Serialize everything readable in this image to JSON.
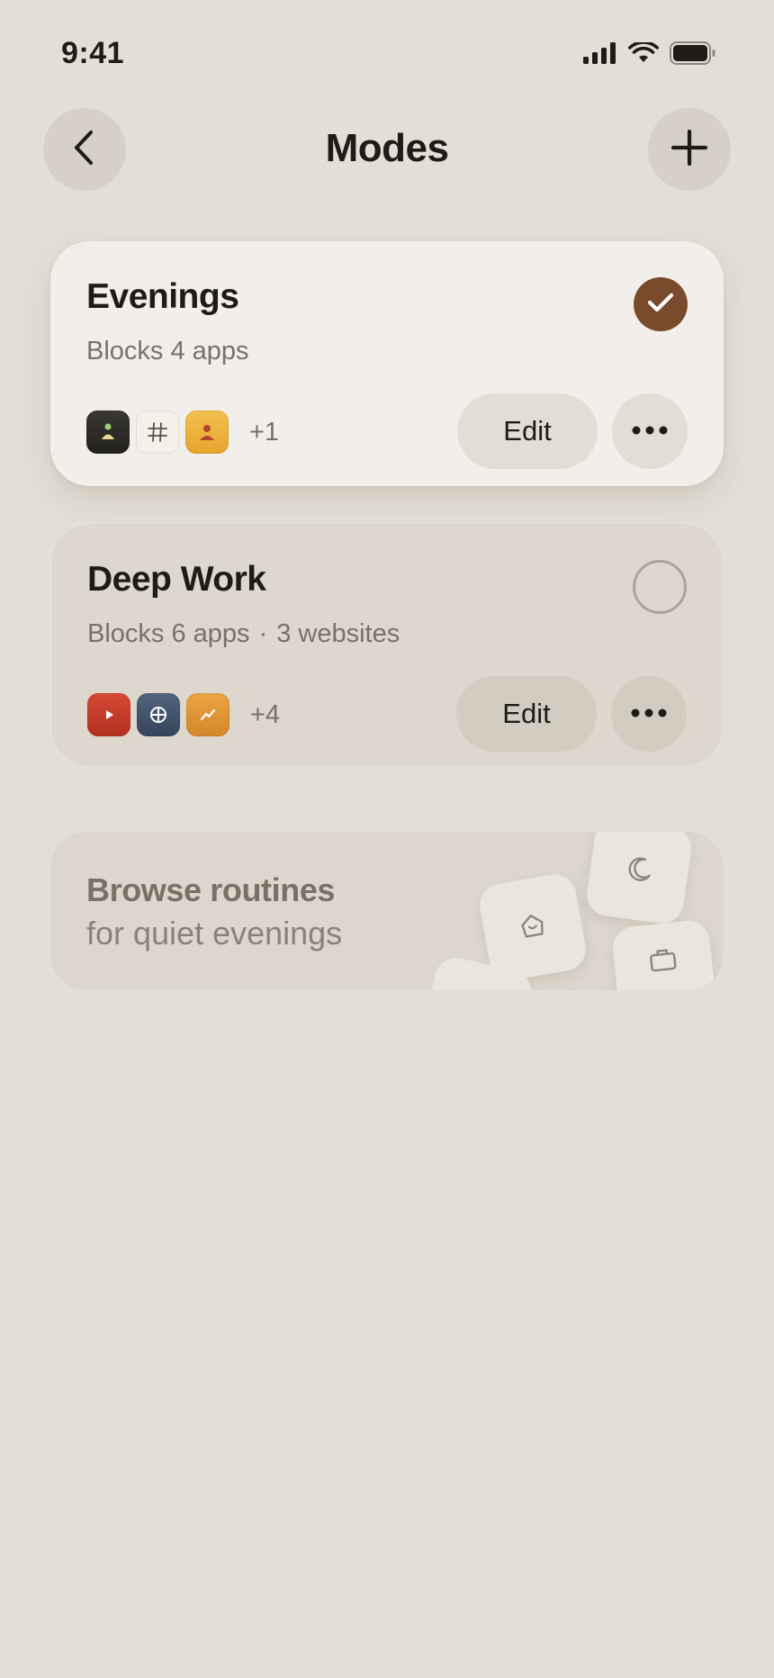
{
  "status_bar": {
    "time": "9:41"
  },
  "header": {
    "title": "Modes"
  },
  "modes": [
    {
      "name": "Evenings",
      "blocks_apps": "Blocks 4 apps",
      "blocks_websites": "",
      "selected": true,
      "apps": [
        "meditation-app-icon",
        "hashtag-app-icon",
        "contacts-app-icon"
      ],
      "more_apps": "+1",
      "edit_label": "Edit"
    },
    {
      "name": "Deep Work",
      "blocks_apps": "Blocks 6 apps",
      "separator": "·",
      "blocks_websites": "3 websites",
      "selected": false,
      "apps": [
        "video-app-icon",
        "browser-app-icon",
        "stocks-app-icon"
      ],
      "more_apps": "+4",
      "edit_label": "Edit"
    }
  ],
  "browse": {
    "title": "Browse routines",
    "subtitle": "for quiet evenings",
    "tiles": [
      "moon-icon",
      "home-icon",
      "briefcase-icon"
    ]
  },
  "colors": {
    "background": "#e4dfd6",
    "active_card": "#f2efea",
    "inactive_card": "#ddd7cd",
    "accent": "#7a4a2c"
  }
}
